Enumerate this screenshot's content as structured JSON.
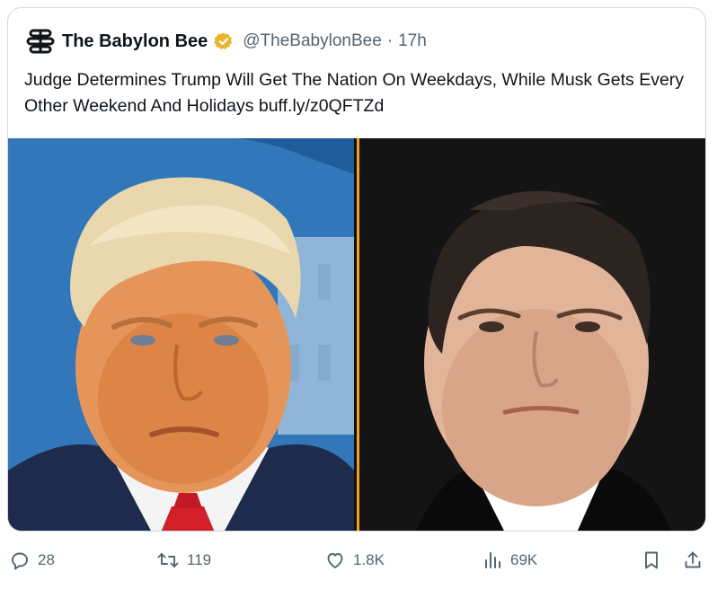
{
  "tweet": {
    "display_name": "The Babylon Bee",
    "handle": "@TheBabylonBee",
    "separator": "·",
    "time": "17h",
    "text": "Judge Determines Trump Will Get The Nation On Weekdays, While Musk Gets Every Other Weekend And Holidays buff.ly/z0QFTZd"
  },
  "actions": {
    "replies": "28",
    "retweets": "119",
    "likes": "1.8K",
    "views": "69K"
  },
  "icons": {
    "avatar": "bee-logo-icon",
    "verified": "verified-badge-icon",
    "reply": "reply-icon",
    "retweet": "retweet-icon",
    "like": "heart-icon",
    "views": "views-chart-icon",
    "bookmark": "bookmark-icon",
    "share": "share-icon"
  },
  "colors": {
    "text": "#0f1419",
    "secondary": "#536471",
    "border": "#cfd9de",
    "verified_gold": "#e8b52b",
    "divider_orange": "#f2a227"
  }
}
